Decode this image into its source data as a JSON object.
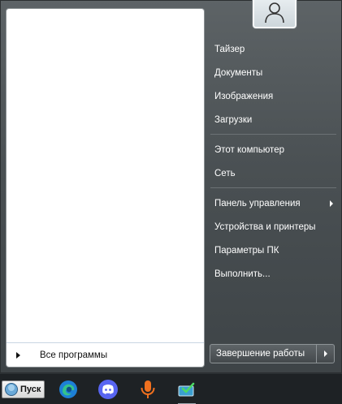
{
  "start_menu": {
    "all_programs_label": "Все программы",
    "right_pane": {
      "user_name": "Тайзер",
      "documents": "Документы",
      "pictures": "Изображения",
      "downloads": "Загрузки",
      "computer": "Этот компьютер",
      "network": "Сеть",
      "control_panel": "Панель управления",
      "devices": "Устройства и принтеры",
      "pc_settings": "Параметры ПК",
      "run": "Выполнить..."
    },
    "shutdown_label": "Завершение работы"
  },
  "taskbar": {
    "start_label": "Пуск",
    "pinned": [
      "edge-icon",
      "discord-icon",
      "microphone-icon",
      "tablet-app-icon"
    ]
  },
  "colors": {
    "menu_bg": "#4a5053",
    "taskbar_bg": "#1e2225",
    "edge_blue": "#1d7fd6",
    "discord": "#5865f2",
    "mic_orange": "#f0701f"
  }
}
